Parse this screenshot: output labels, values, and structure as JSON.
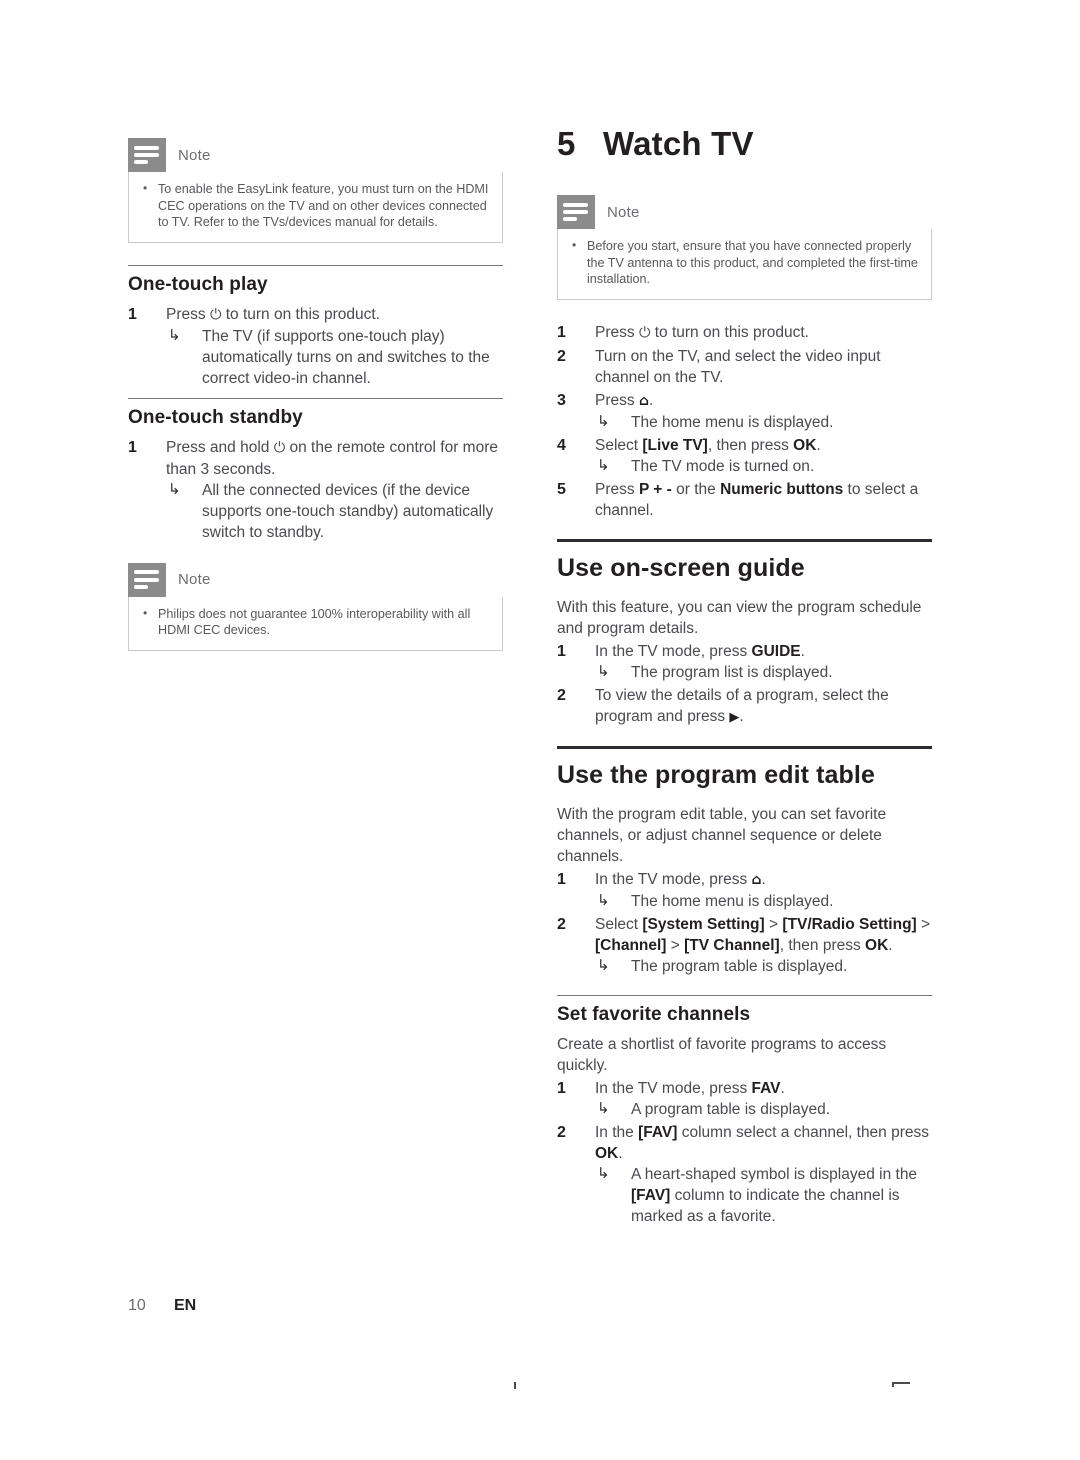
{
  "page": {
    "footer_page_number": "10",
    "footer_language": "EN",
    "colors": {
      "heading": "#231f20",
      "body_text": "#4a4a50",
      "note_icon_bg": "#8b8b8b",
      "thin_rule": "#7a7489",
      "thick_rule": "#2b2b30",
      "note_border": "#c9c9cf"
    }
  },
  "icons": {
    "power": "⏻",
    "home": "⌂",
    "arrow_substep": "↳",
    "play_right": "▶",
    "bullet": "•"
  },
  "left_column": {
    "note_easylink": {
      "title": "Note",
      "items": [
        "To enable the EasyLink feature, you must turn on the HDMI CEC operations on the TV and on other devices connected to TV. Refer to the TVs/devices manual for details."
      ]
    },
    "one_touch_play": {
      "heading": "One-touch play",
      "steps": [
        {
          "num": "1",
          "text_before_icon": "Press ",
          "icon": "power",
          "text_after_icon": " to turn on this product.",
          "subs": [
            "The TV (if supports one-touch play) automatically turns on and switches to the correct video-in channel."
          ]
        }
      ]
    },
    "one_touch_standby": {
      "heading": "One-touch standby",
      "steps": [
        {
          "num": "1",
          "text_before_icon": "Press and hold ",
          "icon": "power",
          "text_after_icon": " on the remote control for more than 3 seconds.",
          "subs": [
            "All the connected devices (if the device supports one-touch standby) automatically switch to standby."
          ]
        }
      ]
    },
    "note_interop": {
      "title": "Note",
      "items": [
        "Philips does not guarantee 100% interoperability with all HDMI CEC devices."
      ]
    }
  },
  "right_column": {
    "chapter": {
      "number": "5",
      "title": "Watch TV"
    },
    "note_before_start": {
      "title": "Note",
      "items": [
        "Before you start, ensure that you have connected properly the TV antenna to this product, and completed the first-time installation."
      ]
    },
    "watch_tv_steps": [
      {
        "num": "1",
        "text_before_icon": "Press ",
        "icon": "power",
        "text_after_icon": " to turn on this product.",
        "subs": []
      },
      {
        "num": "2",
        "text": "Turn on the TV, and select the video input channel on the TV.",
        "subs": []
      },
      {
        "num": "3",
        "text_before_icon": "Press ",
        "icon": "home",
        "text_after_icon": ".",
        "subs": [
          "The home menu is displayed."
        ]
      },
      {
        "num": "4",
        "text_parts": [
          {
            "t": "Select ",
            "b": false
          },
          {
            "t": "[Live TV]",
            "b": true
          },
          {
            "t": ", then press ",
            "b": false
          },
          {
            "t": "OK",
            "b": true
          },
          {
            "t": ".",
            "b": false
          }
        ],
        "subs": [
          "The TV mode is turned on."
        ]
      },
      {
        "num": "5",
        "text_parts": [
          {
            "t": "Press ",
            "b": false
          },
          {
            "t": "P + -",
            "b": true
          },
          {
            "t": " or the ",
            "b": false
          },
          {
            "t": "Numeric buttons",
            "b": true
          },
          {
            "t": " to select a channel.",
            "b": false
          }
        ],
        "subs": []
      }
    ],
    "on_screen_guide": {
      "heading": "Use on-screen guide",
      "intro": "With this feature, you can view the program schedule and program details.",
      "steps": [
        {
          "num": "1",
          "text_parts": [
            {
              "t": "In the TV mode, press ",
              "b": false
            },
            {
              "t": "GUIDE",
              "b": true
            },
            {
              "t": ".",
              "b": false
            }
          ],
          "subs": [
            "The program list is displayed."
          ]
        },
        {
          "num": "2",
          "text_before_icon": "To view the details of a program, select the program and press ",
          "icon": "play_right",
          "text_after_icon": ".",
          "subs": []
        }
      ]
    },
    "program_edit_table": {
      "heading": "Use the program edit table",
      "intro": "With the program edit table, you can set favorite channels, or adjust channel sequence or delete channels.",
      "steps": [
        {
          "num": "1",
          "text_before_icon": "In the TV mode, press ",
          "icon": "home",
          "text_after_icon": ".",
          "subs": [
            "The home menu is displayed."
          ]
        },
        {
          "num": "2",
          "text_parts": [
            {
              "t": "Select ",
              "b": false
            },
            {
              "t": "[System Setting]",
              "b": true
            },
            {
              "t": " > ",
              "b": false
            },
            {
              "t": "[TV/Radio Setting]",
              "b": true
            },
            {
              "t": " > ",
              "b": false
            },
            {
              "t": "[Channel]",
              "b": true
            },
            {
              "t": " > ",
              "b": false
            },
            {
              "t": "[TV Channel]",
              "b": true
            },
            {
              "t": ", then press ",
              "b": false
            },
            {
              "t": "OK",
              "b": true
            },
            {
              "t": ".",
              "b": false
            }
          ],
          "subs": [
            "The program table is displayed."
          ]
        }
      ]
    },
    "set_favorite_channels": {
      "heading": "Set favorite channels",
      "intro": "Create a shortlist of favorite programs to access quickly.",
      "steps": [
        {
          "num": "1",
          "text_parts": [
            {
              "t": "In the TV mode, press ",
              "b": false
            },
            {
              "t": "FAV",
              "b": true
            },
            {
              "t": ".",
              "b": false
            }
          ],
          "subs": [
            "A program table is displayed."
          ]
        },
        {
          "num": "2",
          "text_parts": [
            {
              "t": "In the ",
              "b": false
            },
            {
              "t": "[FAV]",
              "b": true
            },
            {
              "t": " column select a channel, then press ",
              "b": false
            },
            {
              "t": "OK",
              "b": true
            },
            {
              "t": ".",
              "b": false
            }
          ],
          "subs_rich": [
            [
              {
                "t": "A heart-shaped symbol is displayed in the ",
                "b": false
              },
              {
                "t": "[FAV]",
                "b": true
              },
              {
                "t": " column to indicate the channel is marked as a favorite.",
                "b": false
              }
            ]
          ]
        }
      ]
    }
  }
}
